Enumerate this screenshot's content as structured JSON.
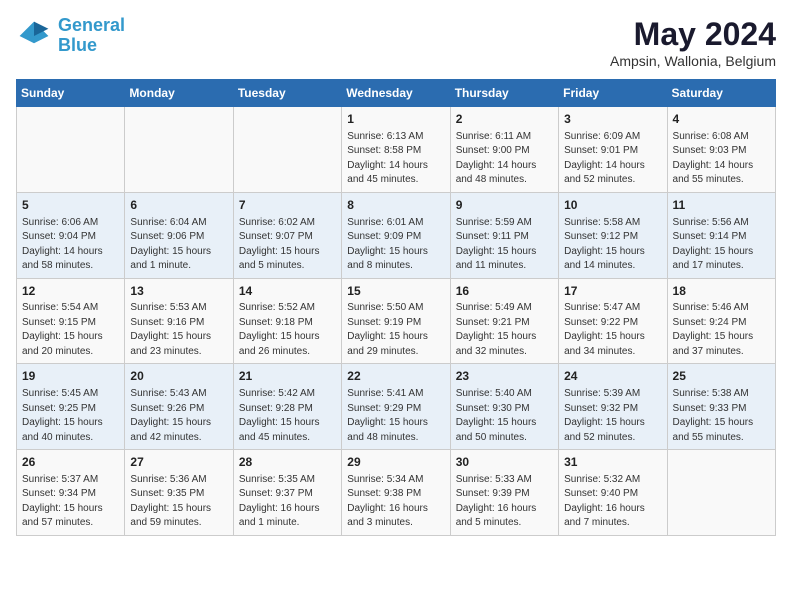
{
  "header": {
    "logo_line1": "General",
    "logo_line2": "Blue",
    "title": "May 2024",
    "subtitle": "Ampsin, Wallonia, Belgium"
  },
  "days_of_week": [
    "Sunday",
    "Monday",
    "Tuesday",
    "Wednesday",
    "Thursday",
    "Friday",
    "Saturday"
  ],
  "weeks": [
    [
      {
        "day": "",
        "content": ""
      },
      {
        "day": "",
        "content": ""
      },
      {
        "day": "",
        "content": ""
      },
      {
        "day": "1",
        "content": "Sunrise: 6:13 AM\nSunset: 8:58 PM\nDaylight: 14 hours\nand 45 minutes."
      },
      {
        "day": "2",
        "content": "Sunrise: 6:11 AM\nSunset: 9:00 PM\nDaylight: 14 hours\nand 48 minutes."
      },
      {
        "day": "3",
        "content": "Sunrise: 6:09 AM\nSunset: 9:01 PM\nDaylight: 14 hours\nand 52 minutes."
      },
      {
        "day": "4",
        "content": "Sunrise: 6:08 AM\nSunset: 9:03 PM\nDaylight: 14 hours\nand 55 minutes."
      }
    ],
    [
      {
        "day": "5",
        "content": "Sunrise: 6:06 AM\nSunset: 9:04 PM\nDaylight: 14 hours\nand 58 minutes."
      },
      {
        "day": "6",
        "content": "Sunrise: 6:04 AM\nSunset: 9:06 PM\nDaylight: 15 hours\nand 1 minute."
      },
      {
        "day": "7",
        "content": "Sunrise: 6:02 AM\nSunset: 9:07 PM\nDaylight: 15 hours\nand 5 minutes."
      },
      {
        "day": "8",
        "content": "Sunrise: 6:01 AM\nSunset: 9:09 PM\nDaylight: 15 hours\nand 8 minutes."
      },
      {
        "day": "9",
        "content": "Sunrise: 5:59 AM\nSunset: 9:11 PM\nDaylight: 15 hours\nand 11 minutes."
      },
      {
        "day": "10",
        "content": "Sunrise: 5:58 AM\nSunset: 9:12 PM\nDaylight: 15 hours\nand 14 minutes."
      },
      {
        "day": "11",
        "content": "Sunrise: 5:56 AM\nSunset: 9:14 PM\nDaylight: 15 hours\nand 17 minutes."
      }
    ],
    [
      {
        "day": "12",
        "content": "Sunrise: 5:54 AM\nSunset: 9:15 PM\nDaylight: 15 hours\nand 20 minutes."
      },
      {
        "day": "13",
        "content": "Sunrise: 5:53 AM\nSunset: 9:16 PM\nDaylight: 15 hours\nand 23 minutes."
      },
      {
        "day": "14",
        "content": "Sunrise: 5:52 AM\nSunset: 9:18 PM\nDaylight: 15 hours\nand 26 minutes."
      },
      {
        "day": "15",
        "content": "Sunrise: 5:50 AM\nSunset: 9:19 PM\nDaylight: 15 hours\nand 29 minutes."
      },
      {
        "day": "16",
        "content": "Sunrise: 5:49 AM\nSunset: 9:21 PM\nDaylight: 15 hours\nand 32 minutes."
      },
      {
        "day": "17",
        "content": "Sunrise: 5:47 AM\nSunset: 9:22 PM\nDaylight: 15 hours\nand 34 minutes."
      },
      {
        "day": "18",
        "content": "Sunrise: 5:46 AM\nSunset: 9:24 PM\nDaylight: 15 hours\nand 37 minutes."
      }
    ],
    [
      {
        "day": "19",
        "content": "Sunrise: 5:45 AM\nSunset: 9:25 PM\nDaylight: 15 hours\nand 40 minutes."
      },
      {
        "day": "20",
        "content": "Sunrise: 5:43 AM\nSunset: 9:26 PM\nDaylight: 15 hours\nand 42 minutes."
      },
      {
        "day": "21",
        "content": "Sunrise: 5:42 AM\nSunset: 9:28 PM\nDaylight: 15 hours\nand 45 minutes."
      },
      {
        "day": "22",
        "content": "Sunrise: 5:41 AM\nSunset: 9:29 PM\nDaylight: 15 hours\nand 48 minutes."
      },
      {
        "day": "23",
        "content": "Sunrise: 5:40 AM\nSunset: 9:30 PM\nDaylight: 15 hours\nand 50 minutes."
      },
      {
        "day": "24",
        "content": "Sunrise: 5:39 AM\nSunset: 9:32 PM\nDaylight: 15 hours\nand 52 minutes."
      },
      {
        "day": "25",
        "content": "Sunrise: 5:38 AM\nSunset: 9:33 PM\nDaylight: 15 hours\nand 55 minutes."
      }
    ],
    [
      {
        "day": "26",
        "content": "Sunrise: 5:37 AM\nSunset: 9:34 PM\nDaylight: 15 hours\nand 57 minutes."
      },
      {
        "day": "27",
        "content": "Sunrise: 5:36 AM\nSunset: 9:35 PM\nDaylight: 15 hours\nand 59 minutes."
      },
      {
        "day": "28",
        "content": "Sunrise: 5:35 AM\nSunset: 9:37 PM\nDaylight: 16 hours\nand 1 minute."
      },
      {
        "day": "29",
        "content": "Sunrise: 5:34 AM\nSunset: 9:38 PM\nDaylight: 16 hours\nand 3 minutes."
      },
      {
        "day": "30",
        "content": "Sunrise: 5:33 AM\nSunset: 9:39 PM\nDaylight: 16 hours\nand 5 minutes."
      },
      {
        "day": "31",
        "content": "Sunrise: 5:32 AM\nSunset: 9:40 PM\nDaylight: 16 hours\nand 7 minutes."
      },
      {
        "day": "",
        "content": ""
      }
    ]
  ]
}
